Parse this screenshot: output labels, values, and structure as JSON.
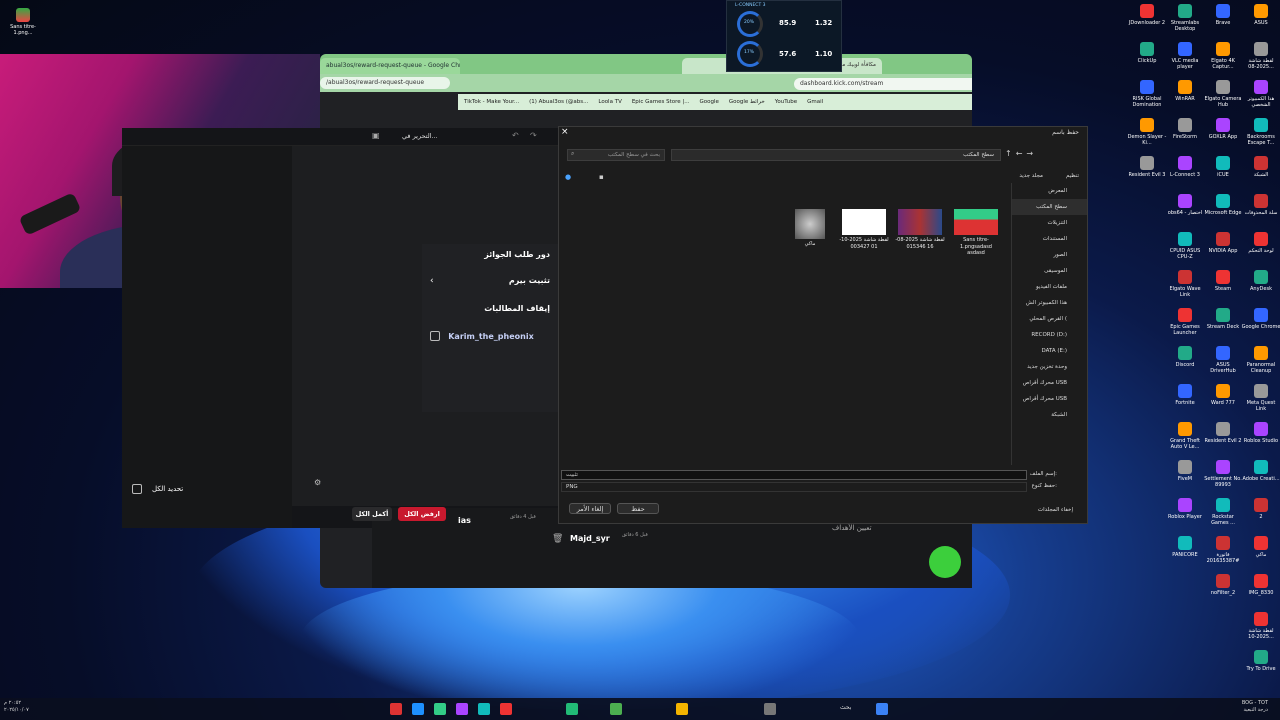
{
  "top_left_icon": {
    "label": "Sans titre-1.png..."
  },
  "stats_overlay": {
    "title": "L-CONNECT 3",
    "ring1": "20%",
    "ring2": "17%",
    "val1": "85.9",
    "val2": "1.32",
    "val3": "57.6",
    "val4": "1.10",
    "unit": "W"
  },
  "chrome": {
    "tab_title": "abual3os/reward-request-queue - Google Chrome",
    "url": "/abual3os/reward-request-queue",
    "tab2": "مكافأة لوبيك مجنونة",
    "kick_url": "dashboard.kick.com/stream",
    "bookmarks": [
      "TikTok - Make Your...",
      "(1) Abual3os (@abs...",
      "Loola TV",
      "Epic Games Store |...",
      "Google",
      "Google خرائط",
      "YouTube",
      "Gmail"
    ]
  },
  "editor": {
    "title": "التحرير في..."
  },
  "rewards": {
    "header": "دور طلب الجوائز",
    "item": "تثبيت بيرم",
    "section": "إيقاف المطالبات",
    "user": "Karim_the_pheonix"
  },
  "bottom": {
    "select_all": "تحديد الكل",
    "complete_all": "أكمل الكل",
    "reject_all": "ارفض الكل",
    "user1": "Majd_syr",
    "time1": "قبل 6 دقائق",
    "time2": "قبل 4 دقائق",
    "partial": "ias",
    "goals": "تعيين الأهداف"
  },
  "dialog": {
    "title": "حفظ باسم",
    "search_placeholder": "بحث في سطح المكتب",
    "path": "سطح المكتب",
    "organize": "تنظيم",
    "new_folder": "مجلد جديد",
    "sidebar": [
      "المعرض",
      "سطح المكتب",
      "التنزيلات",
      "المستندات",
      "الصور",
      "الموسيقى",
      "ملفات الفيديو",
      "هذا الكمبيوتر الش",
      "القرص المحلي (",
      "RECORD (D:)",
      "DATA (E:)",
      "وحدة تخزين جديد",
      "محرك أقراص USB",
      "محرك أقراص USB",
      "الشبكة"
    ],
    "files": [
      {
        "name": "ماكي"
      },
      {
        "name": "لقطة شاشة 2025-10-01 003427"
      },
      {
        "name": "لقطة شاشة 2025-08-16 015346"
      },
      {
        "name": "Sans titre-1.pngsadasd asdasd"
      }
    ],
    "filename_label": "إسم الملف:",
    "filename_value": "تثبيت",
    "type_label": "حفظ كنوع:",
    "type_value": "PNG",
    "save": "حفظ",
    "cancel": "إلغاء الأمر",
    "hide_folders": "إخفاء المجلدات"
  },
  "desktop_icons": [
    [
      "JDownloader 2",
      "Streamlabs Desktop",
      "Brave",
      "ASUS"
    ],
    [
      "ClickUp",
      "VLC media player",
      "Elgato 4K Captur...",
      "لقطة شاشة 2025-08..."
    ],
    [
      "RISK Global Domination",
      "WinRAR",
      "Elgato Camera Hub",
      "هذا الكمبيوتر الشخصي"
    ],
    [
      "Demon Slayer -Ki...",
      "FireStorm",
      "GOXLR App",
      "Backrooms Escape T..."
    ],
    [
      "Resident Evil 3",
      "L-Connect 3",
      "iCUE",
      "الشبكة"
    ],
    [
      "obs64 - اختصار",
      "Microsoft Edge",
      "سلة المحذوفات"
    ],
    [
      "CPUID ASUS CPU-Z",
      "NVIDIA App",
      "لوحة التحكم"
    ],
    [
      "Elgato Wave Link",
      "Steam",
      "AnyDesk"
    ],
    [
      "Epic Games Launcher",
      "Stream Deck",
      "Google Chrome"
    ],
    [
      "Discord",
      "ASUS DriverHub",
      "Paranormal Cleanup"
    ],
    [
      "Fortnite",
      "Ward 777",
      "Meta Quest Link"
    ],
    [
      "Grand Theft Auto V Le...",
      "Resident Evil 2",
      "Roblox Studio"
    ],
    [
      "FiveM",
      "Settlement No. 89993",
      "Adobe Creati..."
    ],
    [
      "Roblox Player",
      "Rockstar Games ...",
      "2"
    ],
    [
      "PANICORE",
      "فاتورة #201635387",
      "ماكي"
    ],
    [
      "noFilter_2",
      "IMG_8330"
    ],
    [
      "لقطة شاشة 2025-10..."
    ],
    [
      "Try To Drive"
    ]
  ],
  "taskbar": {
    "search": "بحث",
    "left_time": "٢٠:٥٢ م",
    "left_date": "٢٠٢٥/١٠/٠٧",
    "right_top": "BOG - TOT",
    "right_bottom": "درجة التبعية"
  }
}
